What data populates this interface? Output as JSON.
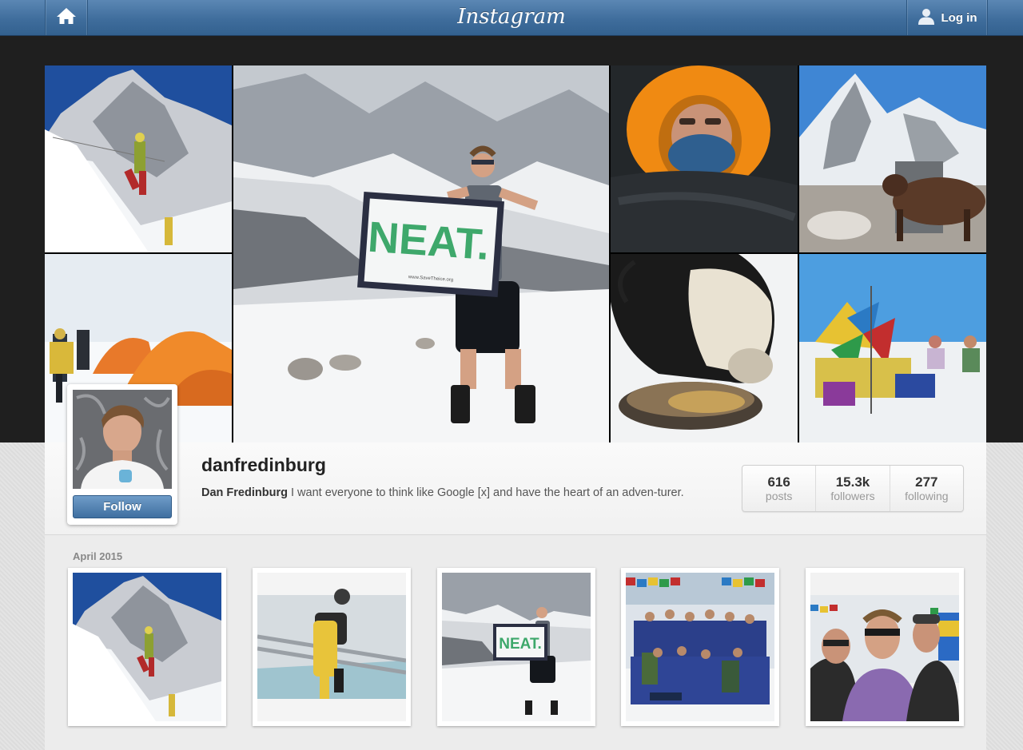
{
  "header": {
    "brand": "Instagram",
    "login_label": "Log in"
  },
  "profile": {
    "username": "danfredinburg",
    "full_name": "Dan Fredinburg",
    "bio": " I want everyone to think like Google [x] and have the heart of an adven-turer.",
    "follow_label": "Follow",
    "stats": [
      {
        "value": "616",
        "label": "posts"
      },
      {
        "value": "15.3k",
        "label": "followers"
      },
      {
        "value": "277",
        "label": "following"
      }
    ]
  },
  "feed": {
    "month_label": "April 2015"
  },
  "photo_text": {
    "flag_main": "NEAT.",
    "flag_url": "www.SaveTheice.org",
    "flag_thumb": "NEAT."
  },
  "colors": {
    "accent": "#3f6d9c",
    "dark_band": "#1f1f1f",
    "follow_button": "#4a7aab"
  },
  "icons": {
    "home": "home-icon",
    "user": "user-icon"
  }
}
